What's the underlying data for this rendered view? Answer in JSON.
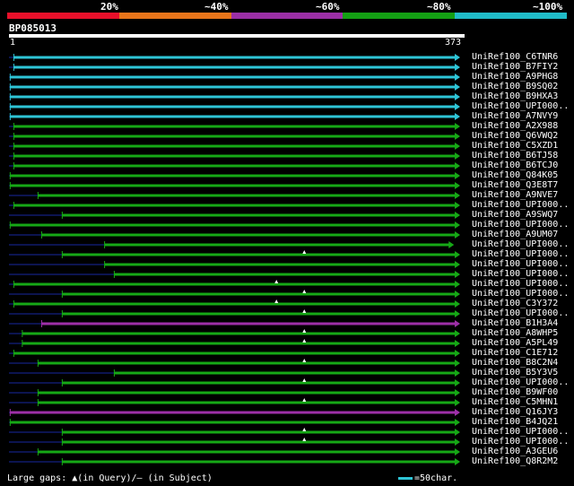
{
  "legend": {
    "labels": [
      "20%",
      "~40%",
      "~60%",
      "~80%",
      "~100%"
    ],
    "colors": [
      "#e8102a",
      "#e8751a",
      "#9b2fa6",
      "#14a014",
      "#20bcc8"
    ]
  },
  "query": {
    "id": "BP085013",
    "start_label": "1",
    "end_label": "373",
    "length": 373
  },
  "hit_colors": {
    "cyan": "#2ec4d6",
    "green": "#16a816",
    "purple": "#9e2fa8",
    "dark": "#0c1450"
  },
  "hits": [
    {
      "name": "UniRef100_C6TNR6",
      "start": 5,
      "end": 373,
      "color": "cyan",
      "marks": []
    },
    {
      "name": "UniRef100_B7FIY2",
      "start": 5,
      "end": 373,
      "color": "cyan",
      "marks": []
    },
    {
      "name": "UniRef100_A9PHG8",
      "start": 2,
      "end": 373,
      "color": "cyan",
      "marks": []
    },
    {
      "name": "UniRef100_B9SQ02",
      "start": 2,
      "end": 373,
      "color": "cyan",
      "marks": []
    },
    {
      "name": "UniRef100_B9HXA3",
      "start": 2,
      "end": 373,
      "color": "cyan",
      "marks": []
    },
    {
      "name": "UniRef100_UPI000..",
      "start": 2,
      "end": 373,
      "color": "cyan",
      "marks": []
    },
    {
      "name": "UniRef100_A7NVY9",
      "start": 2,
      "end": 373,
      "color": "cyan",
      "marks": []
    },
    {
      "name": "UniRef100_A2X988",
      "start": 5,
      "end": 373,
      "color": "green",
      "marks": []
    },
    {
      "name": "UniRef100_Q6VWQ2",
      "start": 5,
      "end": 373,
      "color": "green",
      "marks": []
    },
    {
      "name": "UniRef100_C5XZD1",
      "start": 5,
      "end": 373,
      "color": "green",
      "marks": []
    },
    {
      "name": "UniRef100_B6TJ58",
      "start": 5,
      "end": 373,
      "color": "green",
      "marks": []
    },
    {
      "name": "UniRef100_B6TCJ0",
      "start": 5,
      "end": 373,
      "color": "green",
      "marks": []
    },
    {
      "name": "UniRef100_Q84K05",
      "start": 2,
      "end": 373,
      "color": "green",
      "marks": []
    },
    {
      "name": "UniRef100_Q3E8T7",
      "start": 2,
      "end": 373,
      "color": "green",
      "marks": []
    },
    {
      "name": "UniRef100_A9NVE7",
      "start": 25,
      "end": 373,
      "color": "green",
      "marks": []
    },
    {
      "name": "UniRef100_UPI000..",
      "start": 5,
      "end": 373,
      "color": "green",
      "marks": []
    },
    {
      "name": "UniRef100_A9SWQ7",
      "start": 45,
      "end": 373,
      "color": "green",
      "marks": []
    },
    {
      "name": "UniRef100_UPI000..",
      "start": 2,
      "end": 373,
      "color": "green",
      "marks": []
    },
    {
      "name": "UniRef100_A9UM07",
      "start": 28,
      "end": 373,
      "color": "green",
      "marks": []
    },
    {
      "name": "UniRef100_UPI000..",
      "start": 80,
      "end": 368,
      "color": "green",
      "marks": []
    },
    {
      "name": "UniRef100_UPI000..",
      "start": 45,
      "end": 373,
      "color": "green",
      "marks": [
        245
      ]
    },
    {
      "name": "UniRef100_UPI000..",
      "start": 80,
      "end": 373,
      "color": "green",
      "marks": []
    },
    {
      "name": "UniRef100_UPI000..",
      "start": 88,
      "end": 373,
      "color": "green",
      "marks": []
    },
    {
      "name": "UniRef100_UPI000..",
      "start": 5,
      "end": 373,
      "color": "green",
      "marks": [
        222
      ]
    },
    {
      "name": "UniRef100_UPI000..",
      "start": 45,
      "end": 373,
      "color": "green",
      "marks": [
        245
      ]
    },
    {
      "name": "UniRef100_C3Y372",
      "start": 5,
      "end": 373,
      "color": "green",
      "marks": [
        222
      ]
    },
    {
      "name": "UniRef100_UPI000..",
      "start": 45,
      "end": 373,
      "color": "green",
      "marks": [
        245
      ]
    },
    {
      "name": "UniRef100_B1H3A4",
      "start": 28,
      "end": 373,
      "color": "purple",
      "marks": []
    },
    {
      "name": "UniRef100_A8WHP5",
      "start": 12,
      "end": 373,
      "color": "green",
      "marks": [
        245
      ]
    },
    {
      "name": "UniRef100_A5PL49",
      "start": 12,
      "end": 373,
      "color": "green",
      "marks": [
        245
      ]
    },
    {
      "name": "UniRef100_C1E712",
      "start": 5,
      "end": 373,
      "color": "green",
      "marks": []
    },
    {
      "name": "UniRef100_B8C2N4",
      "start": 25,
      "end": 373,
      "color": "green",
      "marks": [
        245
      ]
    },
    {
      "name": "UniRef100_B5Y3V5",
      "start": 88,
      "end": 373,
      "color": "green",
      "marks": []
    },
    {
      "name": "UniRef100_UPI000..",
      "start": 45,
      "end": 373,
      "color": "green",
      "marks": [
        245
      ]
    },
    {
      "name": "UniRef100_B9WF00",
      "start": 25,
      "end": 373,
      "color": "green",
      "marks": []
    },
    {
      "name": "UniRef100_C5MHN1",
      "start": 25,
      "end": 373,
      "color": "green",
      "marks": [
        245
      ]
    },
    {
      "name": "UniRef100_Q16JY3",
      "start": 2,
      "end": 373,
      "color": "purple",
      "marks": []
    },
    {
      "name": "UniRef100_B4JQ21",
      "start": 2,
      "end": 373,
      "color": "green",
      "marks": []
    },
    {
      "name": "UniRef100_UPI000..",
      "start": 45,
      "end": 373,
      "color": "green",
      "marks": [
        245
      ]
    },
    {
      "name": "UniRef100_UPI000..",
      "start": 45,
      "end": 373,
      "color": "green",
      "marks": [
        245
      ]
    },
    {
      "name": "UniRef100_A3GEU6",
      "start": 25,
      "end": 373,
      "color": "green",
      "marks": []
    },
    {
      "name": "UniRef100_Q8R2M2",
      "start": 45,
      "end": 373,
      "color": "green",
      "marks": []
    }
  ],
  "footer": {
    "gaps_label": "Large gaps:",
    "query_mark": "▲",
    "query_text": "(in Query)/",
    "subject_mark": "⁄",
    "subject_text": "– (in Subject)",
    "scale_text": "=50char."
  }
}
